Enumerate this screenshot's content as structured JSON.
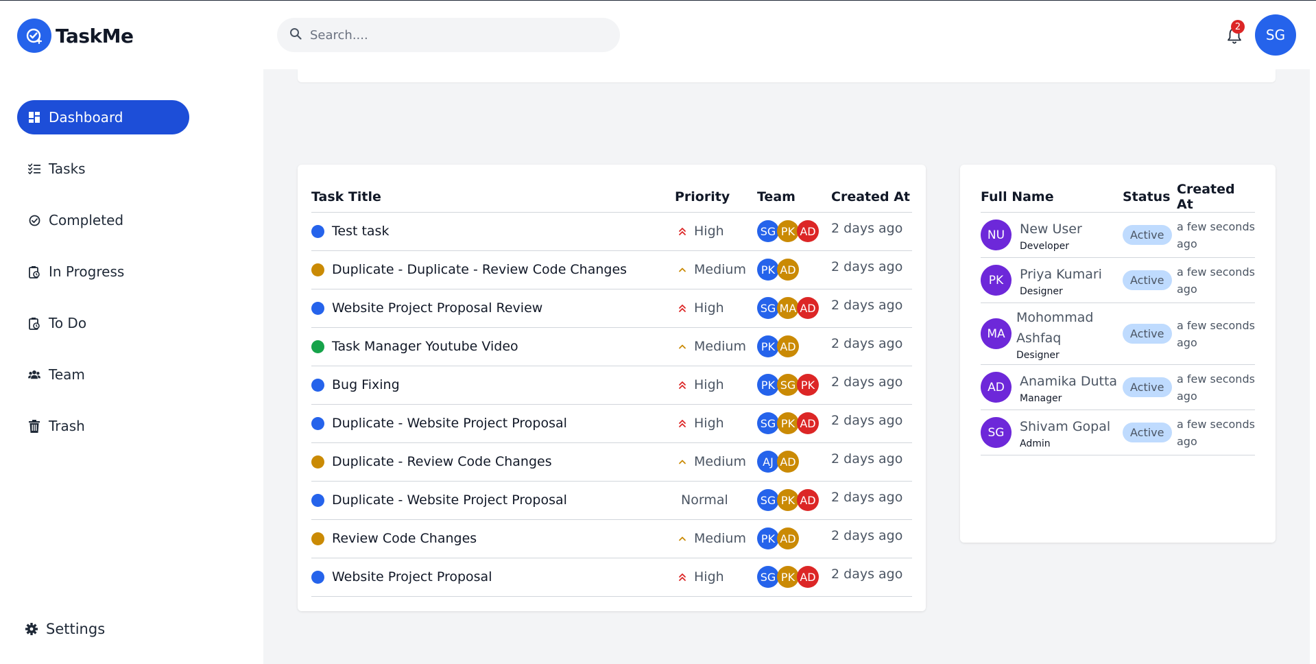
{
  "app": {
    "name": "TaskMe"
  },
  "search": {
    "placeholder": "Search...."
  },
  "notifications": {
    "count": "2"
  },
  "current_user": {
    "initials": "SG"
  },
  "sidebar": {
    "items": [
      {
        "label": "Dashboard",
        "icon": "dashboard-icon",
        "active": true
      },
      {
        "label": "Tasks",
        "icon": "tasks-icon"
      },
      {
        "label": "Completed",
        "icon": "completed-icon"
      },
      {
        "label": "In Progress",
        "icon": "in-progress-icon"
      },
      {
        "label": "To Do",
        "icon": "todo-icon"
      },
      {
        "label": "Team",
        "icon": "team-icon"
      },
      {
        "label": "Trash",
        "icon": "trash-icon"
      }
    ],
    "settings_label": "Settings"
  },
  "tasks_table": {
    "headers": {
      "title": "Task Title",
      "priority": "Priority",
      "team": "Team",
      "created": "Created At"
    },
    "rows": [
      {
        "title": "Test task",
        "stage_color": "#2563eb",
        "priority": "High",
        "team": [
          {
            "i": "SG",
            "c": "#2563eb"
          },
          {
            "i": "PK",
            "c": "#ca8a04"
          },
          {
            "i": "AD",
            "c": "#dc2626"
          }
        ],
        "created": "2 days ago"
      },
      {
        "title": "Duplicate - Duplicate - Review Code Changes",
        "stage_color": "#ca8a04",
        "priority": "Medium",
        "team": [
          {
            "i": "PK",
            "c": "#2563eb"
          },
          {
            "i": "AD",
            "c": "#ca8a04"
          }
        ],
        "created": "2 days ago"
      },
      {
        "title": "Website Project Proposal Review",
        "stage_color": "#2563eb",
        "priority": "High",
        "team": [
          {
            "i": "SG",
            "c": "#2563eb"
          },
          {
            "i": "MA",
            "c": "#ca8a04"
          },
          {
            "i": "AD",
            "c": "#dc2626"
          }
        ],
        "created": "2 days ago"
      },
      {
        "title": "Task Manager Youtube Video",
        "stage_color": "#16a34a",
        "priority": "Medium",
        "team": [
          {
            "i": "PK",
            "c": "#2563eb"
          },
          {
            "i": "AD",
            "c": "#ca8a04"
          }
        ],
        "created": "2 days ago"
      },
      {
        "title": "Bug Fixing",
        "stage_color": "#2563eb",
        "priority": "High",
        "team": [
          {
            "i": "PK",
            "c": "#2563eb"
          },
          {
            "i": "SG",
            "c": "#ca8a04"
          },
          {
            "i": "PK",
            "c": "#dc2626"
          }
        ],
        "created": "2 days ago"
      },
      {
        "title": "Duplicate - Website Project Proposal",
        "stage_color": "#2563eb",
        "priority": "High",
        "team": [
          {
            "i": "SG",
            "c": "#2563eb"
          },
          {
            "i": "PK",
            "c": "#ca8a04"
          },
          {
            "i": "AD",
            "c": "#dc2626"
          }
        ],
        "created": "2 days ago"
      },
      {
        "title": "Duplicate - Review Code Changes",
        "stage_color": "#ca8a04",
        "priority": "Medium",
        "team": [
          {
            "i": "AJ",
            "c": "#2563eb"
          },
          {
            "i": "AD",
            "c": "#ca8a04"
          }
        ],
        "created": "2 days ago"
      },
      {
        "title": "Duplicate - Website Project Proposal",
        "stage_color": "#2563eb",
        "priority": "Normal",
        "team": [
          {
            "i": "SG",
            "c": "#2563eb"
          },
          {
            "i": "PK",
            "c": "#ca8a04"
          },
          {
            "i": "AD",
            "c": "#dc2626"
          }
        ],
        "created": "2 days ago"
      },
      {
        "title": "Review Code Changes",
        "stage_color": "#ca8a04",
        "priority": "Medium",
        "team": [
          {
            "i": "PK",
            "c": "#2563eb"
          },
          {
            "i": "AD",
            "c": "#ca8a04"
          }
        ],
        "created": "2 days ago"
      },
      {
        "title": "Website Project Proposal",
        "stage_color": "#2563eb",
        "priority": "High",
        "team": [
          {
            "i": "SG",
            "c": "#2563eb"
          },
          {
            "i": "PK",
            "c": "#ca8a04"
          },
          {
            "i": "AD",
            "c": "#dc2626"
          }
        ],
        "created": "2 days ago"
      }
    ]
  },
  "users_table": {
    "headers": {
      "name": "Full Name",
      "status": "Status",
      "created": "Created At"
    },
    "rows": [
      {
        "initials": "NU",
        "name": "New User",
        "role": "Developer",
        "status": "Active",
        "created_1": "a few seconds",
        "created_2": "ago"
      },
      {
        "initials": "PK",
        "name": "Priya Kumari",
        "role": "Designer",
        "status": "Active",
        "created_1": "a few seconds",
        "created_2": "ago"
      },
      {
        "initials": "MA",
        "name_1": "Mohommad",
        "name_2": "Ashfaq",
        "role": "Designer",
        "status": "Active",
        "created_1": "a few seconds",
        "created_2": "ago"
      },
      {
        "initials": "AD",
        "name": "Anamika Dutta",
        "role": "Manager",
        "status": "Active",
        "created_1": "a few seconds",
        "created_2": "ago"
      },
      {
        "initials": "SG",
        "name": "Shivam Gopal",
        "role": "Admin",
        "status": "Active",
        "created_1": "a few seconds",
        "created_2": "ago"
      }
    ]
  },
  "colors": {
    "primary": "#2563eb",
    "active_nav": "#1d4ed8",
    "high": "#dc2626",
    "medium": "#ca8a04",
    "user_avatar": "#6d28d9",
    "status_badge": "#bfdbfe"
  }
}
